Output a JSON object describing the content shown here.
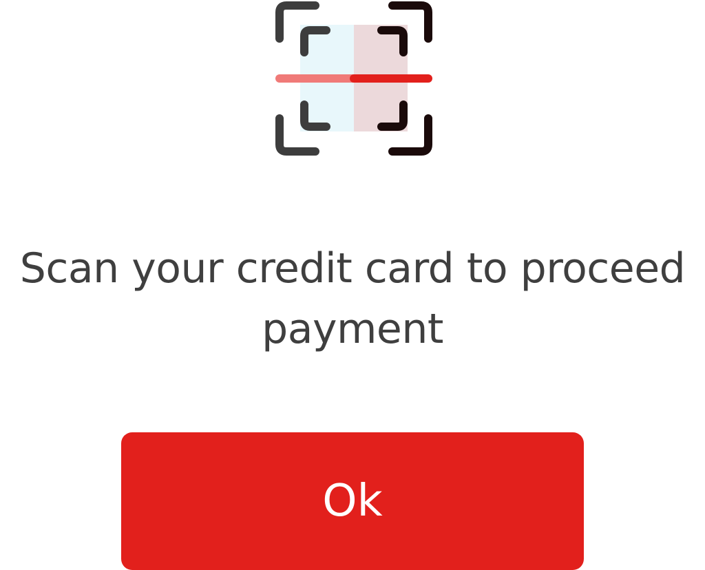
{
  "illustration": {
    "icon": "card-scan-icon",
    "colors": {
      "frame_left": "#3d3d3d",
      "frame_right": "#1a0a0a",
      "card_left": "#e8f7fb",
      "card_right": "#ecd9db",
      "scan_line_left": "#f07a78",
      "scan_line_right": "#e2201c"
    }
  },
  "message": {
    "text": "Scan your credit card to proceed payment"
  },
  "ok_button": {
    "label": "Ok",
    "color": "#e2201c"
  }
}
